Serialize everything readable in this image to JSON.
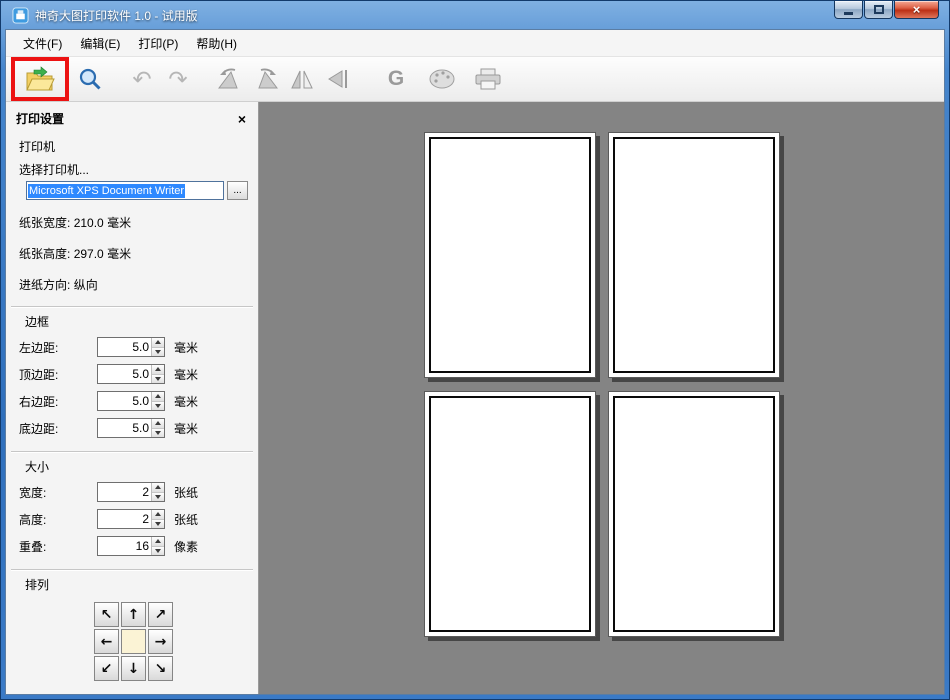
{
  "window": {
    "title": "神奇大图打印软件 1.0 - 试用版",
    "close_glyph": "×"
  },
  "menu": {
    "items": [
      {
        "label": "文件(F)"
      },
      {
        "label": "编辑(E)"
      },
      {
        "label": "打印(P)"
      },
      {
        "label": "帮助(H)"
      }
    ]
  },
  "toolbar": {
    "buttons": [
      {
        "name": "open-file"
      },
      {
        "name": "zoom-preview"
      },
      {
        "name": "undo",
        "glyph": "↶"
      },
      {
        "name": "redo",
        "glyph": "↷"
      },
      {
        "name": "rotate-left"
      },
      {
        "name": "rotate-right"
      },
      {
        "name": "flip-horizontal"
      },
      {
        "name": "flip-vertical"
      },
      {
        "name": "grayscale",
        "glyph": "G"
      },
      {
        "name": "color-effects"
      },
      {
        "name": "print"
      }
    ]
  },
  "panel": {
    "title": "打印设置",
    "close_glyph": "×",
    "printer": {
      "section_label": "打印机",
      "select_label": "选择打印机...",
      "name": "Microsoft XPS Document Writer",
      "browse_label": "...",
      "paper_width_label": "纸张宽度:",
      "paper_width": "210.0",
      "paper_height_label": "纸张高度:",
      "paper_height": "297.0",
      "mm_unit": "毫米",
      "feed_label": "进纸方向:",
      "feed_value": "纵向"
    },
    "margins": {
      "section_label": "边框",
      "rows": [
        {
          "label": "左边距:",
          "value": "5.0",
          "unit": "毫米"
        },
        {
          "label": "顶边距:",
          "value": "5.0",
          "unit": "毫米"
        },
        {
          "label": "右边距:",
          "value": "5.0",
          "unit": "毫米"
        },
        {
          "label": "底边距:",
          "value": "5.0",
          "unit": "毫米"
        }
      ]
    },
    "size": {
      "section_label": "大小",
      "rows": [
        {
          "label": "宽度:",
          "value": "2",
          "unit": "张纸"
        },
        {
          "label": "高度:",
          "value": "2",
          "unit": "张纸"
        },
        {
          "label": "重叠:",
          "value": "16",
          "unit": "像素"
        }
      ]
    },
    "arrange": {
      "section_label": "排列",
      "arrows": [
        "↖",
        "↑",
        "↗",
        "←",
        "",
        "→",
        "↙",
        "↓",
        "↘"
      ]
    }
  },
  "preview": {
    "page_count": 4,
    "grid": "2x2"
  },
  "colors": {
    "titlebar_blue": "#2f6fbc",
    "selection_blue": "#2e89ff",
    "annotation_red": "#ec1212",
    "preview_gray": "#848484"
  }
}
